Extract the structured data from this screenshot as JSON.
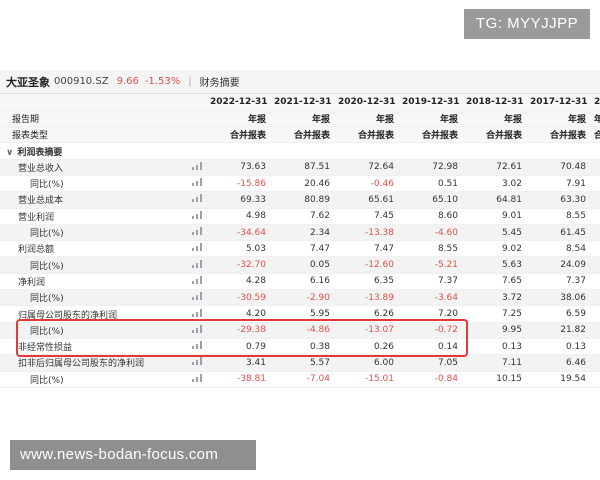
{
  "badge": "TG: MYYJJPP",
  "watermark": "www.news-bodan-focus.com",
  "stock": {
    "name": "大亚圣象",
    "code": "000910.SZ",
    "price": "9.66",
    "change": "-1.53%",
    "separator": "|",
    "tab": "财务摘要"
  },
  "header": {
    "years": [
      "2022-12-31",
      "2021-12-31",
      "2020-12-31",
      "2019-12-31",
      "2018-12-31",
      "2017-12-31",
      "2"
    ],
    "row_period_label": "报告期",
    "row_period_values": [
      "年报",
      "年报",
      "年报",
      "年报",
      "年报",
      "年报",
      "年"
    ],
    "row_type_label": "报表类型",
    "row_type_values": [
      "合并报表",
      "合并报表",
      "合并报表",
      "合并报表",
      "合并报表",
      "合并报表",
      "合"
    ]
  },
  "section": {
    "chevron": "∨",
    "label": "利润表摘要"
  },
  "rows": [
    {
      "label": "营业总收入",
      "values": [
        "73.63",
        "87.51",
        "72.64",
        "72.98",
        "72.61",
        "70.48"
      ],
      "neg": [
        false,
        false,
        false,
        false,
        false,
        false
      ]
    },
    {
      "label": "同比(%)",
      "values": [
        "-15.86",
        "20.46",
        "-0.46",
        "0.51",
        "3.02",
        "7.91"
      ],
      "neg": [
        true,
        false,
        true,
        false,
        false,
        false
      ]
    },
    {
      "label": "营业总成本",
      "values": [
        "69.33",
        "80.89",
        "65.61",
        "65.10",
        "64.81",
        "63.30"
      ],
      "neg": [
        false,
        false,
        false,
        false,
        false,
        false
      ]
    },
    {
      "label": "营业利润",
      "values": [
        "4.98",
        "7.62",
        "7.45",
        "8.60",
        "9.01",
        "8.55"
      ],
      "neg": [
        false,
        false,
        false,
        false,
        false,
        false
      ]
    },
    {
      "label": "同比(%)",
      "values": [
        "-34.64",
        "2.34",
        "-13.38",
        "-4.60",
        "5.45",
        "61.45"
      ],
      "neg": [
        true,
        false,
        true,
        true,
        false,
        false
      ]
    },
    {
      "label": "利润总额",
      "values": [
        "5.03",
        "7.47",
        "7.47",
        "8.55",
        "9.02",
        "8.54"
      ],
      "neg": [
        false,
        false,
        false,
        false,
        false,
        false
      ]
    },
    {
      "label": "同比(%)",
      "values": [
        "-32.70",
        "0.05",
        "-12.60",
        "-5.21",
        "5.63",
        "24.09"
      ],
      "neg": [
        true,
        false,
        true,
        true,
        false,
        false
      ]
    },
    {
      "label": "净利润",
      "values": [
        "4.28",
        "6.16",
        "6.35",
        "7.37",
        "7.65",
        "7.37"
      ],
      "neg": [
        false,
        false,
        false,
        false,
        false,
        false
      ]
    },
    {
      "label": "同比(%)",
      "values": [
        "-30.59",
        "-2.90",
        "-13.89",
        "-3.64",
        "3.72",
        "38.06"
      ],
      "neg": [
        true,
        true,
        true,
        true,
        false,
        false
      ]
    },
    {
      "label": "归属母公司股东的净利润",
      "values": [
        "4.20",
        "5.95",
        "6.26",
        "7.20",
        "7.25",
        "6.59"
      ],
      "neg": [
        false,
        false,
        false,
        false,
        false,
        false
      ]
    },
    {
      "label": "同比(%)",
      "values": [
        "-29.38",
        "-4.86",
        "-13.07",
        "-0.72",
        "9.95",
        "21.82"
      ],
      "neg": [
        true,
        true,
        true,
        true,
        false,
        false
      ]
    },
    {
      "label": "非经常性损益",
      "values": [
        "0.79",
        "0.38",
        "0.26",
        "0.14",
        "0.13",
        "0.13"
      ],
      "neg": [
        false,
        false,
        false,
        false,
        false,
        false
      ]
    },
    {
      "label": "扣非后归属母公司股东的净利润",
      "values": [
        "3.41",
        "5.57",
        "6.00",
        "7.05",
        "7.11",
        "6.46"
      ],
      "neg": [
        false,
        false,
        false,
        false,
        false,
        false
      ]
    },
    {
      "label": "同比(%)",
      "values": [
        "-38.81",
        "-7.04",
        "-15.01",
        "-0.84",
        "10.15",
        "19.54"
      ],
      "neg": [
        true,
        true,
        true,
        true,
        false,
        false
      ]
    }
  ],
  "colors": {
    "negative": "#d9534f",
    "highlight": "#e53935"
  }
}
